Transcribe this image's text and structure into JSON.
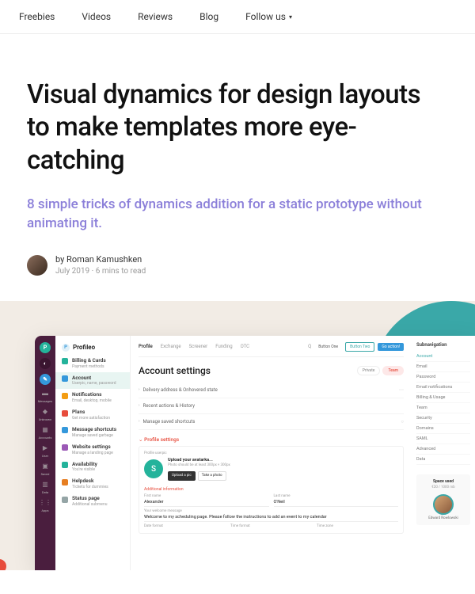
{
  "nav": {
    "items": [
      "Freebies",
      "Videos",
      "Reviews",
      "Blog"
    ],
    "follow": "Follow us"
  },
  "article": {
    "title": "Visual dynamics for design layouts to make templates more eye-catching",
    "subtitle": "8 simple tricks of dynamics addition for a static prototype without animating it.",
    "author": "by Roman Kamushken",
    "date": "July 2019",
    "readtime": "6 mins to read"
  },
  "mockup": {
    "logo": "Profileo",
    "logo_badge": "P",
    "rail": [
      {
        "label": "Messages"
      },
      {
        "label": "Unknown"
      },
      {
        "label": "Accounts"
      },
      {
        "label": "User"
      },
      {
        "label": "Saved"
      },
      {
        "label": "Data"
      },
      {
        "label": "Apps"
      }
    ],
    "menu": [
      {
        "icon": "#24b39b",
        "title": "Billing & Cards",
        "sub": "Payment methods"
      },
      {
        "icon": "#3498db",
        "title": "Account",
        "sub": "Userpic, name, password",
        "active": true
      },
      {
        "icon": "#f39c12",
        "title": "Notifications",
        "sub": "Email, desktop, mobile"
      },
      {
        "icon": "#e74c3c",
        "title": "Plans",
        "sub": "Get more satisfaction"
      },
      {
        "icon": "#3498db",
        "title": "Message shortcuts",
        "sub": "Manage saved garbage"
      },
      {
        "icon": "#9b59b6",
        "title": "Website settings",
        "sub": "Manage a landing page"
      },
      {
        "icon": "#24b39b",
        "title": "Availability",
        "sub": "You're visible"
      },
      {
        "icon": "#e67e22",
        "title": "Helpdesk",
        "sub": "Tickets for dummies"
      },
      {
        "icon": "#95a5a6",
        "title": "Status page",
        "sub": "Additional submenu"
      }
    ],
    "tabs": [
      "Profile",
      "Exchange",
      "Screener",
      "Funding",
      "OTC"
    ],
    "search": "Q",
    "btn1": "Button One",
    "btn2": "Button Two",
    "btn3": "Go action!",
    "h1": "Account settings",
    "chip1": "Private",
    "chip2": "Team",
    "rows": [
      "Delivery address & Onhovered state",
      "Recent actions & History",
      "Manage saved shortcuts"
    ],
    "section": "Profile settings",
    "profile": {
      "label": "Profile userpic",
      "avatar": "S",
      "ut": "Upload your avatarka...",
      "us": "Photo should be at least 300px × 300px",
      "b1": "Upload a pic",
      "b2": "Take a photo"
    },
    "addinfo": "Additional information",
    "fields": {
      "fn_label": "First name",
      "fn": "Alexander",
      "ln_label": "Last name",
      "ln": "O'Neil",
      "wm_label": "Your welcome message",
      "wm": "Welcome to my scheduling page. Please follow the instructions to add an event to my calendar",
      "df": "Date format",
      "tf": "Time format",
      "tz": "Time zone"
    },
    "subnav": {
      "title": "Subnavigation",
      "items": [
        "Account",
        "Email",
        "Password",
        "Email notifications",
        "Billing & Usage",
        "Team",
        "Security",
        "Domains",
        "SAML",
        "Advanced",
        "Data"
      ]
    },
    "space": {
      "label": "Space used",
      "val": "€20 / 1000 mb",
      "user": "Edward Rowlowski"
    }
  }
}
